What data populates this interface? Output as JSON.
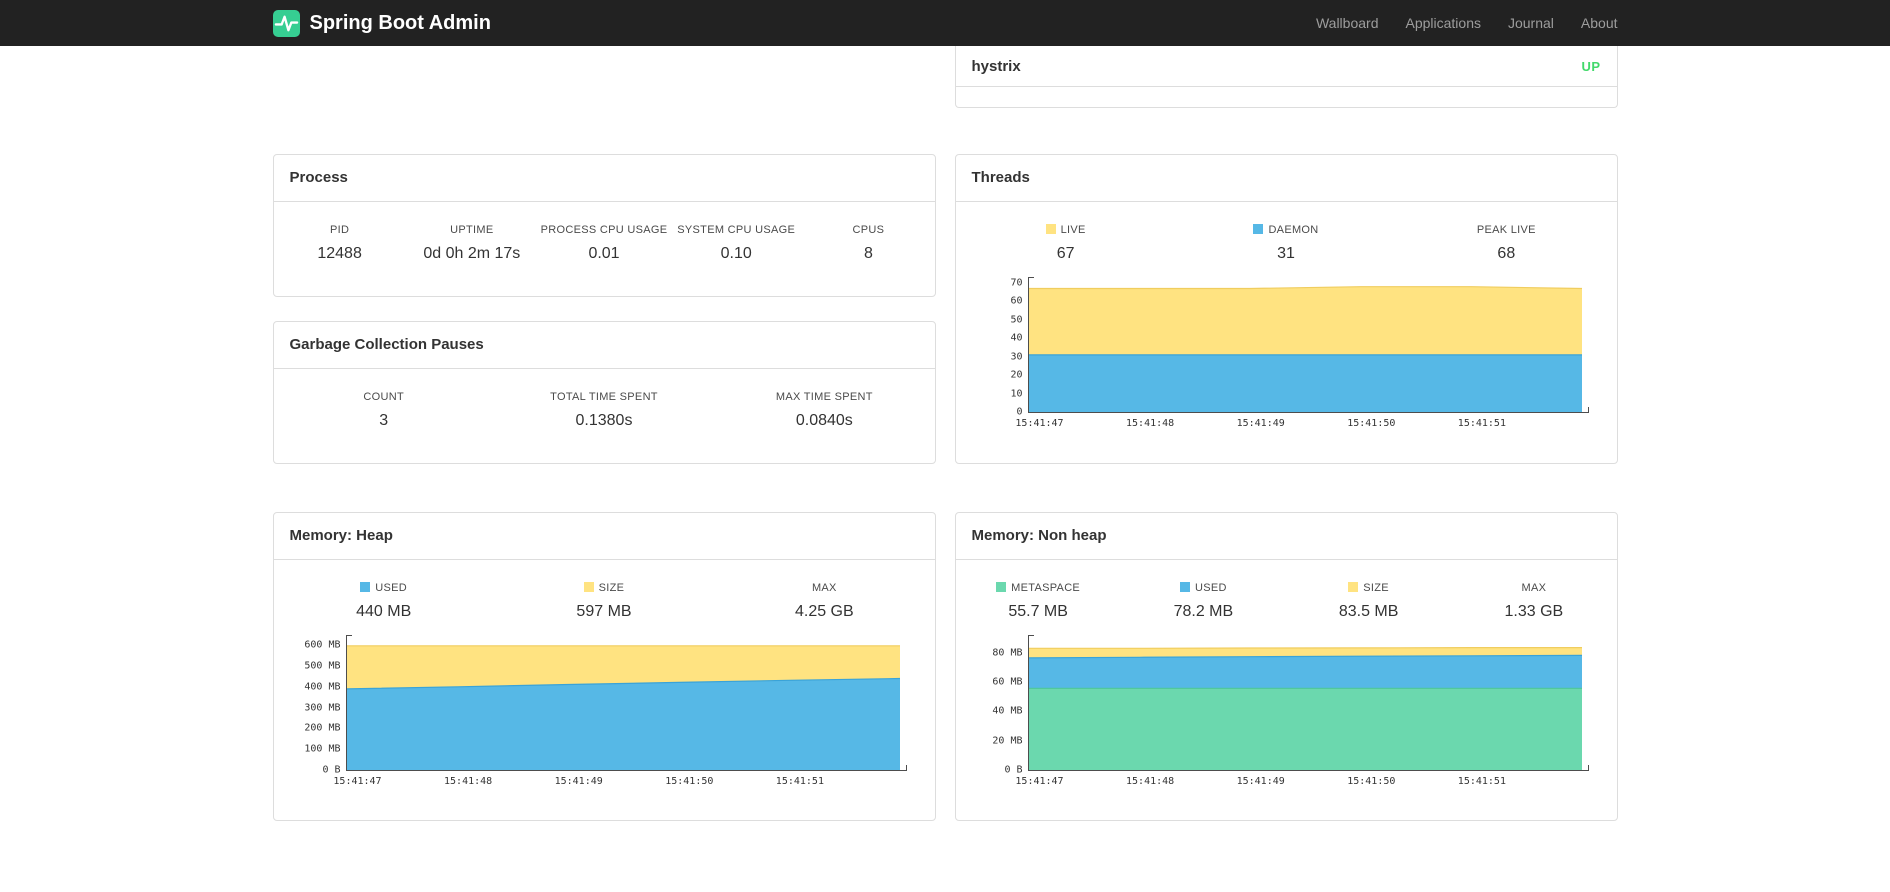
{
  "navbar": {
    "brand": "Spring Boot Admin",
    "items": [
      {
        "label": "Wallboard"
      },
      {
        "label": "Applications"
      },
      {
        "label": "Journal"
      },
      {
        "label": "About"
      }
    ]
  },
  "application_status_panel": {
    "application_name": "hystrix",
    "status": "UP",
    "status_color": "#42d96b"
  },
  "panels": {
    "process": {
      "title": "Process",
      "stats": [
        {
          "label": "PID",
          "value": "12488"
        },
        {
          "label": "UPTIME",
          "value": "0d 0h 2m 17s"
        },
        {
          "label": "PROCESS CPU USAGE",
          "value": "0.01"
        },
        {
          "label": "SYSTEM CPU USAGE",
          "value": "0.10"
        },
        {
          "label": "CPUS",
          "value": "8"
        }
      ]
    },
    "gc": {
      "title": "Garbage Collection Pauses",
      "stats": [
        {
          "label": "COUNT",
          "value": "3"
        },
        {
          "label": "TOTAL TIME SPENT",
          "value": "0.1380s"
        },
        {
          "label": "MAX TIME SPENT",
          "value": "0.0840s"
        }
      ]
    },
    "threads": {
      "title": "Threads",
      "legend": [
        {
          "label": "LIVE",
          "value": "67",
          "color": "#ffe381"
        },
        {
          "label": "DAEMON",
          "value": "31",
          "color": "#56b8e6"
        },
        {
          "label": "PEAK LIVE",
          "value": "68"
        }
      ]
    },
    "memory_heap": {
      "title": "Memory: Heap",
      "legend": [
        {
          "label": "USED",
          "value": "440 MB",
          "color": "#56b8e6"
        },
        {
          "label": "SIZE",
          "value": "597 MB",
          "color": "#ffe381"
        },
        {
          "label": "MAX",
          "value": "4.25 GB"
        }
      ]
    },
    "memory_nonheap": {
      "title": "Memory: Non heap",
      "legend": [
        {
          "label": "METASPACE",
          "value": "55.7 MB",
          "color": "#6bd8ae"
        },
        {
          "label": "USED",
          "value": "78.2 MB",
          "color": "#56b8e6"
        },
        {
          "label": "SIZE",
          "value": "83.5 MB",
          "color": "#ffe381"
        },
        {
          "label": "MAX",
          "value": "1.33 GB"
        }
      ]
    }
  },
  "colors": {
    "navbar_bg": "#222222",
    "brand_green": "#36ce92",
    "panel_border": "#dddddd",
    "series_blue": "#56b8e6",
    "series_yellow": "#ffe381",
    "series_green": "#6bd8ae",
    "status_up": "#42d96b"
  },
  "chart_data": [
    {
      "id": "threads",
      "type": "area",
      "title": "Threads",
      "ylim": [
        0,
        70
      ],
      "yticks": [
        {
          "v": 0,
          "label": "0"
        },
        {
          "v": 10,
          "label": "10"
        },
        {
          "v": 20,
          "label": "20"
        },
        {
          "v": 30,
          "label": "30"
        },
        {
          "v": 40,
          "label": "40"
        },
        {
          "v": 50,
          "label": "50"
        },
        {
          "v": 60,
          "label": "60"
        },
        {
          "v": 70,
          "label": "70"
        }
      ],
      "xticks": [
        "15:41:47",
        "15:41:48",
        "15:41:49",
        "15:41:50",
        "15:41:51"
      ],
      "series": [
        {
          "name": "LIVE",
          "color": "#ffe381",
          "stroke": "#f0cd5f",
          "values": [
            67,
            67,
            67,
            68,
            68,
            67
          ]
        },
        {
          "name": "DAEMON",
          "color": "#56b8e6",
          "stroke": "#3aa3d8",
          "values": [
            31,
            31,
            31,
            31,
            31,
            31
          ]
        }
      ]
    },
    {
      "id": "memory-heap",
      "type": "area",
      "title": "Memory: Heap",
      "ylim": [
        0,
        620
      ],
      "yticks": [
        {
          "v": 0,
          "label": "0 B"
        },
        {
          "v": 100,
          "label": "100 MB"
        },
        {
          "v": 200,
          "label": "200 MB"
        },
        {
          "v": 300,
          "label": "300 MB"
        },
        {
          "v": 400,
          "label": "400 MB"
        },
        {
          "v": 500,
          "label": "500 MB"
        },
        {
          "v": 600,
          "label": "600 MB"
        }
      ],
      "xticks": [
        "15:41:47",
        "15:41:48",
        "15:41:49",
        "15:41:50",
        "15:41:51"
      ],
      "series": [
        {
          "name": "SIZE",
          "color": "#ffe381",
          "stroke": "#f0cd5f",
          "values": [
            597,
            597,
            597,
            597,
            597,
            597
          ]
        },
        {
          "name": "USED",
          "color": "#56b8e6",
          "stroke": "#3aa3d8",
          "values": [
            390,
            400,
            411,
            421,
            431,
            440
          ]
        }
      ]
    },
    {
      "id": "memory-nonheap",
      "type": "area",
      "title": "Memory: Non heap",
      "ylim": [
        0,
        88
      ],
      "yticks": [
        {
          "v": 0,
          "label": "0 B"
        },
        {
          "v": 20,
          "label": "20 MB"
        },
        {
          "v": 40,
          "label": "40 MB"
        },
        {
          "v": 60,
          "label": "60 MB"
        },
        {
          "v": 80,
          "label": "80 MB"
        }
      ],
      "xticks": [
        "15:41:47",
        "15:41:48",
        "15:41:49",
        "15:41:50",
        "15:41:51"
      ],
      "series": [
        {
          "name": "SIZE",
          "color": "#ffe381",
          "stroke": "#f0cd5f",
          "values": [
            83,
            83,
            83.2,
            83.3,
            83.5,
            83.5
          ]
        },
        {
          "name": "USED",
          "color": "#56b8e6",
          "stroke": "#3aa3d8",
          "values": [
            76.5,
            76.9,
            77.3,
            77.6,
            77.9,
            78.2
          ]
        },
        {
          "name": "METASPACE",
          "color": "#6bd8ae",
          "stroke": "#4cc69a",
          "values": [
            55.7,
            55.7,
            55.7,
            55.7,
            55.7,
            55.7
          ]
        }
      ]
    }
  ]
}
